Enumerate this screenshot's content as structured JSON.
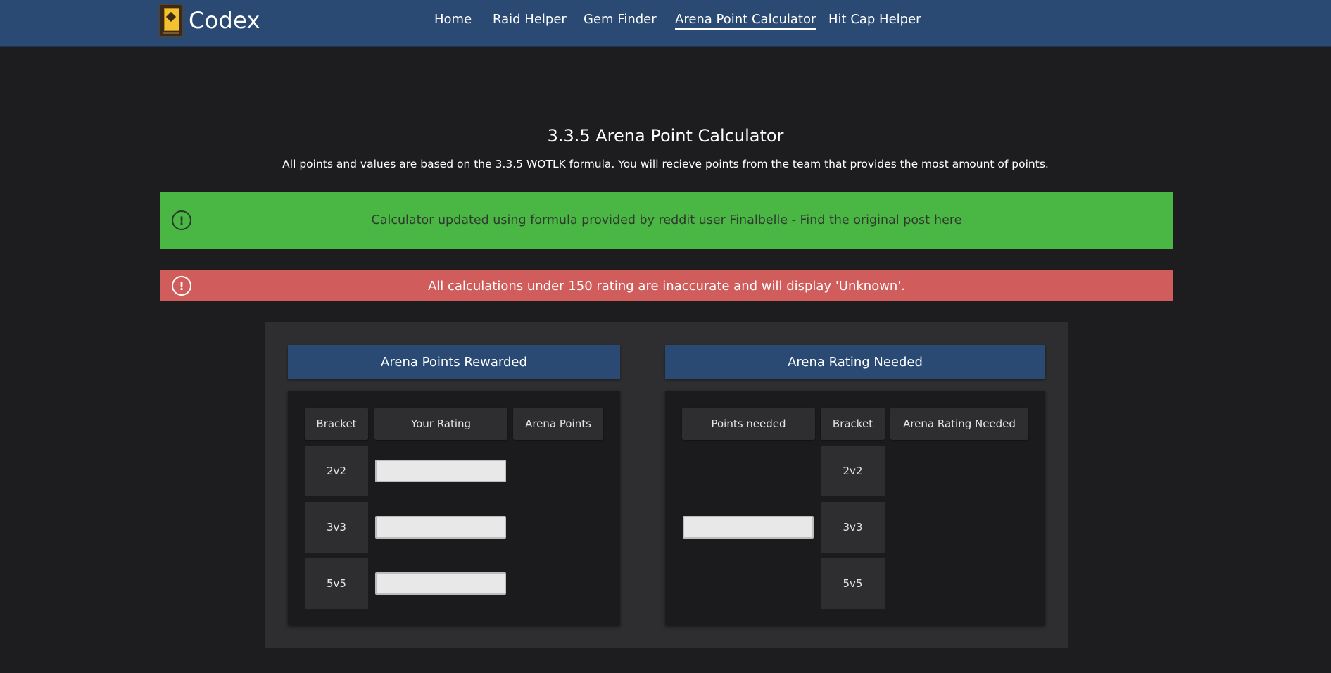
{
  "nav": {
    "brand": "Codex",
    "links": [
      {
        "label": "Home"
      },
      {
        "label": "Raid Helper"
      },
      {
        "label": "Gem Finder"
      },
      {
        "label": "Arena Point Calculator",
        "active": true
      },
      {
        "label": "Hit Cap Helper"
      }
    ]
  },
  "page": {
    "title": "3.3.5 Arena Point Calculator",
    "subtitle": "All points and values are based on the 3.3.5 WOTLK formula. You will recieve points from the team that provides the most amount of points."
  },
  "alerts": {
    "info": {
      "text": "Calculator updated using formula provided by reddit user Finalbelle - Find the original post",
      "link": "here",
      "icon": "alert-circle-icon",
      "color": "#4ab644"
    },
    "warning": {
      "text": "All calculations under 150 rating are inaccurate and will display 'Unknown'.",
      "icon": "alert-circle-icon",
      "color": "#d05d5b"
    }
  },
  "points_rewarded": {
    "title": "Arena Points Rewarded",
    "headers": [
      "Bracket",
      "Your Rating",
      "Arena Points"
    ],
    "rows": [
      {
        "bracket": "2v2",
        "rating": "",
        "points": ""
      },
      {
        "bracket": "3v3",
        "rating": "",
        "points": ""
      },
      {
        "bracket": "5v5",
        "rating": "",
        "points": ""
      }
    ]
  },
  "rating_needed": {
    "title": "Arena Rating Needed",
    "headers": [
      "Points needed",
      "Bracket",
      "Arena Rating Needed"
    ],
    "points_needed": "",
    "rows": [
      {
        "bracket": "2v2",
        "rating": ""
      },
      {
        "bracket": "3v3",
        "rating": ""
      },
      {
        "bracket": "5v5",
        "rating": ""
      }
    ]
  },
  "colors": {
    "background": "#1d1d1f",
    "navbar": "#2a4a73",
    "panel": "#2e2e31",
    "card_body": "#1b1b1d"
  }
}
